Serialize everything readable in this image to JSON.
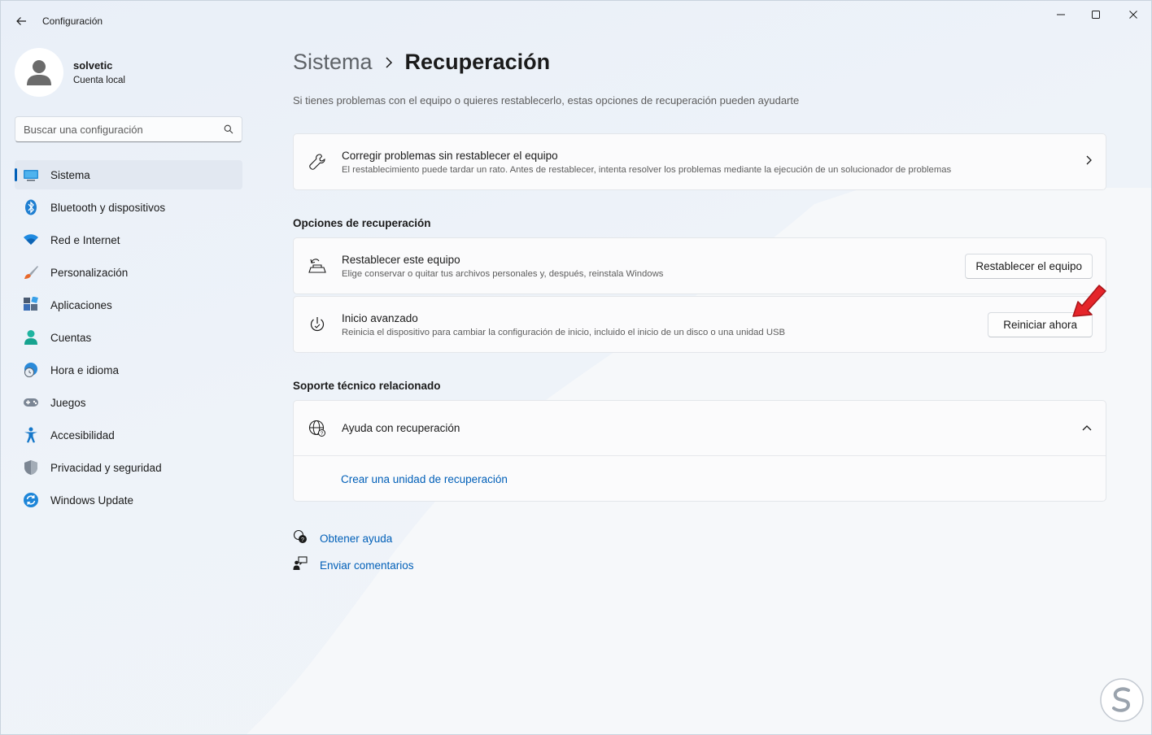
{
  "window": {
    "title": "Configuración"
  },
  "profile": {
    "name": "solvetic",
    "account_type": "Cuenta local"
  },
  "search": {
    "placeholder": "Buscar una configuración"
  },
  "sidebar": {
    "items": [
      {
        "label": "Sistema",
        "icon": "system-icon",
        "active": true
      },
      {
        "label": "Bluetooth y dispositivos",
        "icon": "bluetooth-icon"
      },
      {
        "label": "Red e Internet",
        "icon": "wifi-icon"
      },
      {
        "label": "Personalización",
        "icon": "brush-icon"
      },
      {
        "label": "Aplicaciones",
        "icon": "apps-icon"
      },
      {
        "label": "Cuentas",
        "icon": "person-icon"
      },
      {
        "label": "Hora e idioma",
        "icon": "globe-clock-icon"
      },
      {
        "label": "Juegos",
        "icon": "gamepad-icon"
      },
      {
        "label": "Accesibilidad",
        "icon": "accessibility-icon"
      },
      {
        "label": "Privacidad y seguridad",
        "icon": "shield-icon"
      },
      {
        "label": "Windows Update",
        "icon": "update-icon"
      }
    ]
  },
  "header": {
    "parent": "Sistema",
    "current": "Recuperación",
    "subtitle": "Si tienes problemas con el equipo o quieres restablecerlo, estas opciones de recuperación pueden ayudarte"
  },
  "troubleshoot": {
    "title": "Corregir problemas sin restablecer el equipo",
    "description": "El restablecimiento puede tardar un rato. Antes de restablecer, intenta resolver los problemas mediante la ejecución de un solucionador de problemas"
  },
  "recovery_options": {
    "section_title": "Opciones de recuperación",
    "reset": {
      "title": "Restablecer este equipo",
      "description": "Elige conservar o quitar tus archivos personales y, después, reinstala Windows",
      "button": "Restablecer el equipo"
    },
    "advanced": {
      "title": "Inicio avanzado",
      "description": "Reinicia el dispositivo para cambiar la configuración de inicio, incluido el inicio de un disco o una unidad USB",
      "button": "Reiniciar ahora"
    }
  },
  "support": {
    "section_title": "Soporte técnico relacionado",
    "help_title": "Ayuda con recuperación",
    "link": "Crear una unidad de recuperación"
  },
  "footer": {
    "get_help": "Obtener ayuda",
    "feedback": "Enviar comentarios"
  },
  "colors": {
    "accent": "#005fb8",
    "annotation_arrow": "#e5252a"
  }
}
